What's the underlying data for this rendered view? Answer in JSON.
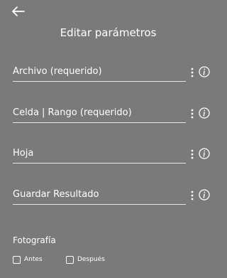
{
  "header": {
    "back_icon": "arrow-left-icon",
    "title": "Editar parámetros"
  },
  "fields": [
    {
      "label": "Archivo (requerido)",
      "menu_icon": "kebab-menu-icon",
      "info_icon": "info-icon"
    },
    {
      "label": "Celda | Rango (requerido)",
      "menu_icon": "kebab-menu-icon",
      "info_icon": "info-icon"
    },
    {
      "label": "Hoja",
      "menu_icon": "kebab-menu-icon",
      "info_icon": "info-icon"
    },
    {
      "label": "Guardar Resultado",
      "menu_icon": "kebab-menu-icon",
      "info_icon": "info-icon"
    }
  ],
  "photo": {
    "title": "Fotografía",
    "options": [
      {
        "label": "Antes",
        "checked": false
      },
      {
        "label": "Después",
        "checked": false
      }
    ]
  },
  "colors": {
    "background": "#7a7a7a",
    "text": "#ffffff",
    "underline": "#e6e6e6"
  }
}
